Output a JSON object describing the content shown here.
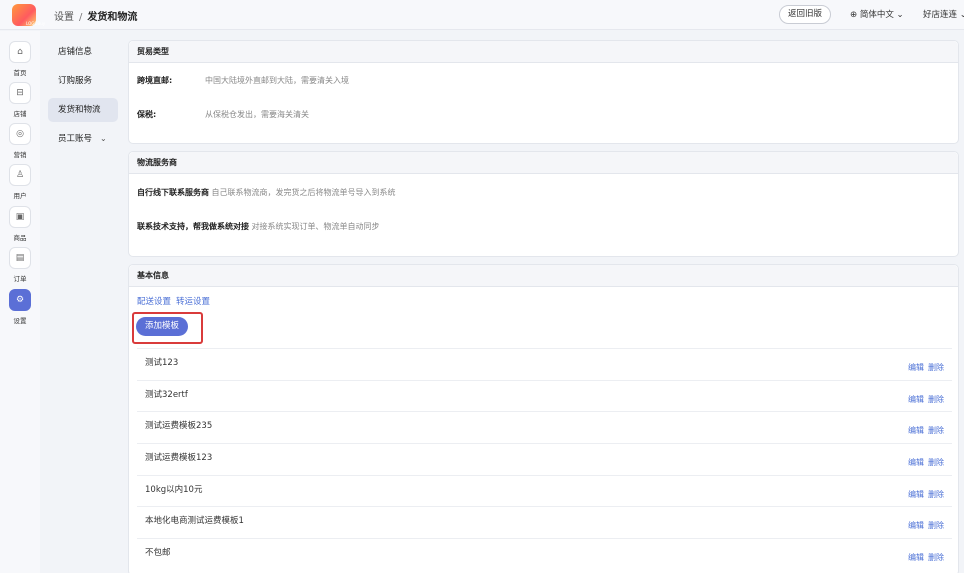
{
  "header": {
    "logo_text": "LOGOBuy",
    "breadcrumb": [
      "设置",
      "发货和物流"
    ],
    "back_button": "返回旧版",
    "language": "简体中文",
    "shop_name": "好店连连"
  },
  "rail": [
    {
      "label": "首页",
      "icon": "home-icon",
      "glyph": "⌂"
    },
    {
      "label": "店铺",
      "icon": "store-icon",
      "glyph": "⊟"
    },
    {
      "label": "营销",
      "icon": "marketing-icon",
      "glyph": "◎"
    },
    {
      "label": "用户",
      "icon": "user-icon",
      "glyph": "♙"
    },
    {
      "label": "商品",
      "icon": "goods-icon",
      "glyph": "▣"
    },
    {
      "label": "订单",
      "icon": "order-icon",
      "glyph": "▤"
    },
    {
      "label": "设置",
      "icon": "settings-icon",
      "glyph": "⚙"
    }
  ],
  "subnav": [
    "店铺信息",
    "订购服务",
    "发货和物流",
    "员工账号"
  ],
  "trade": {
    "title": "贸易类型",
    "rows": [
      {
        "key": "跨境直邮:",
        "value": "中国大陆境外直邮到大陆，需要清关入境"
      },
      {
        "key": "保税:",
        "value": "从保税仓发出，需要海关清关"
      }
    ]
  },
  "logistics": {
    "title": "物流服务商",
    "rows": [
      {
        "key": "自行线下联系服务商",
        "value": "自己联系物流商，发完货之后将物流单号导入到系统"
      },
      {
        "key": "联系技术支持，帮我做系统对接",
        "value": "对接系统实现订单、物流单自动同步"
      }
    ]
  },
  "basic": {
    "title": "基本信息",
    "tab1": "配送设置",
    "tab2": "转运设置",
    "add_button": "添加模板",
    "edit_label": "编辑",
    "delete_label": "删除",
    "templates": [
      "测试123",
      "测试32ertf",
      "测试运费模板235",
      "测试运费模板123",
      "10kg以内10元",
      "本地化电商测试运费模板1",
      "不包邮"
    ]
  }
}
